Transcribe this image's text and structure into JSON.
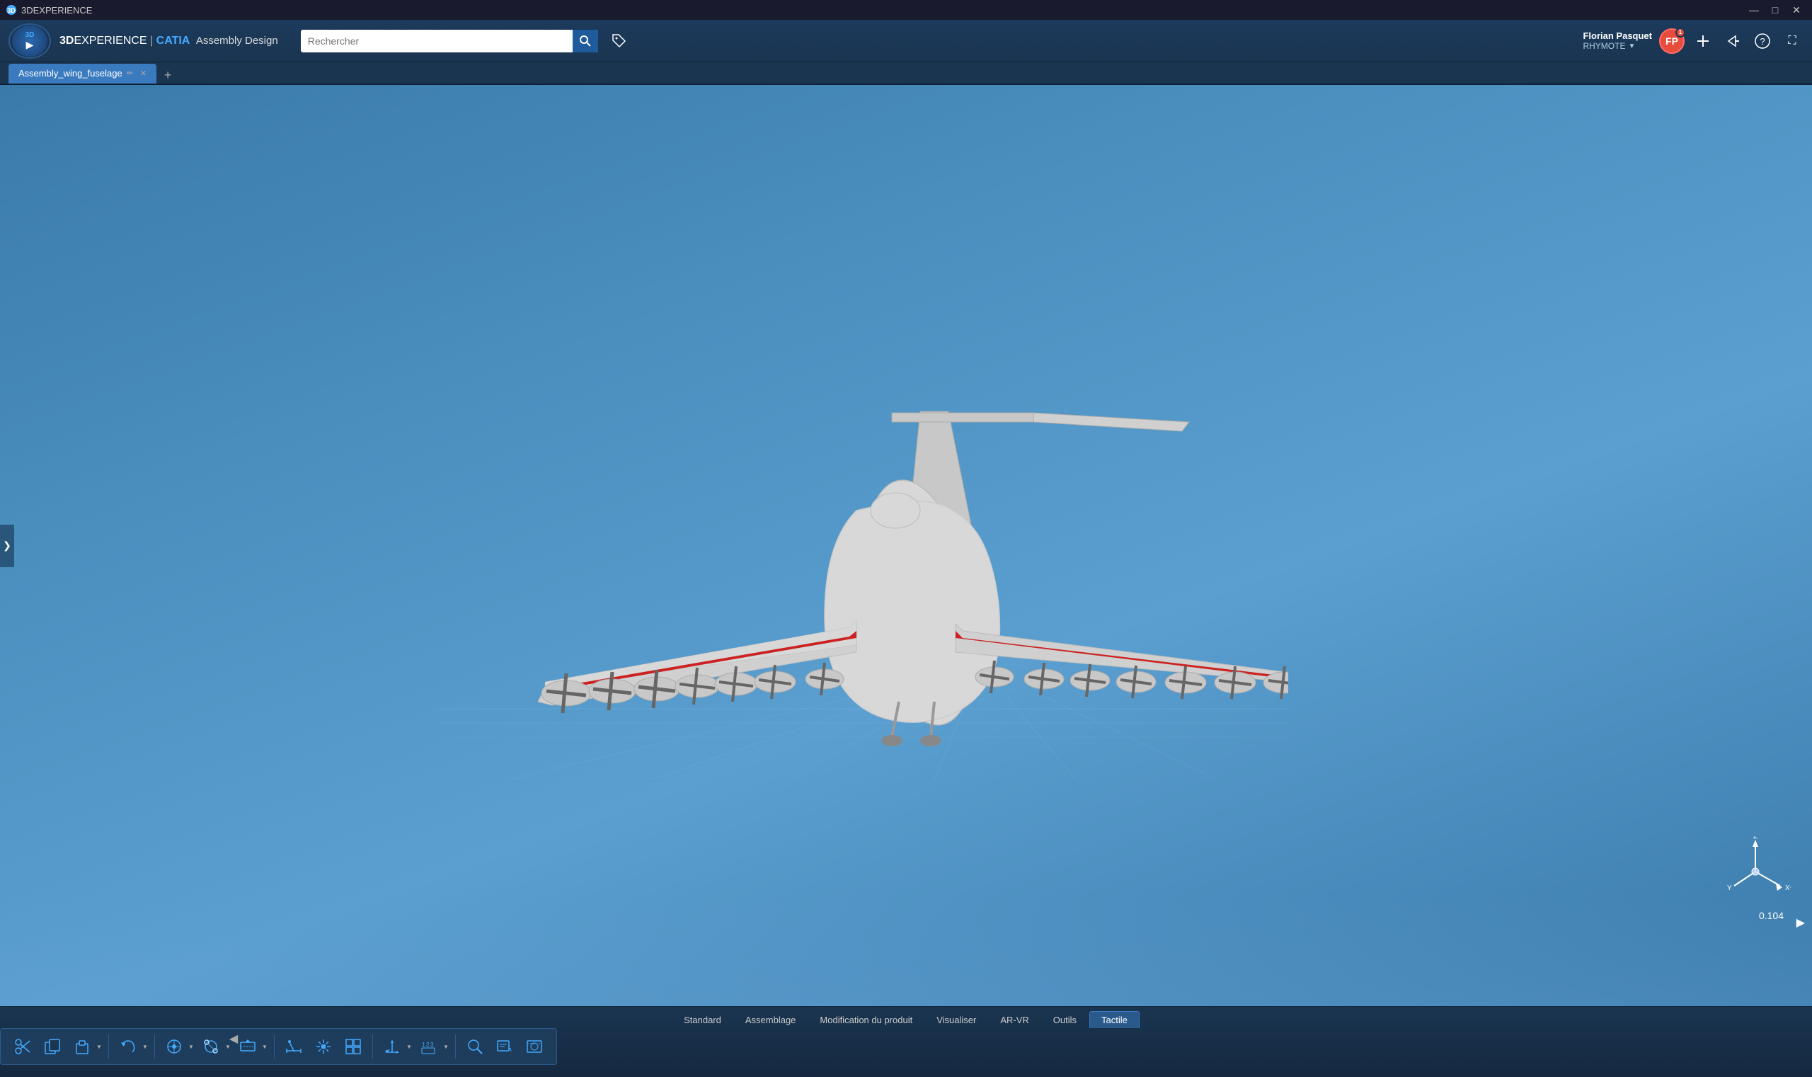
{
  "window": {
    "title": "3DEXPERIENCE",
    "minimize_label": "—",
    "maximize_label": "□",
    "close_label": "✕"
  },
  "header": {
    "app_prefix": "3D",
    "app_experience": "EXPERIENCE",
    "separator": " | ",
    "catia": "CATIA",
    "module": "Assembly Design",
    "search_placeholder": "Rechercher",
    "user_name": "Florian Pasquet",
    "workspace": "RHYMOTE",
    "avatar_initials": "FP"
  },
  "tabs": [
    {
      "label": "Assembly_wing_fuselage",
      "active": true
    },
    {
      "label": "+",
      "is_add": true
    }
  ],
  "viewport": {
    "coordinates": "0.104"
  },
  "sidebar": {
    "expand_icon": "❯"
  },
  "bottom_tabs": [
    {
      "label": "Standard",
      "active": false
    },
    {
      "label": "Assemblage",
      "active": false
    },
    {
      "label": "Modification du produit",
      "active": false
    },
    {
      "label": "Visualiser",
      "active": false
    },
    {
      "label": "AR-VR",
      "active": false
    },
    {
      "label": "Outils",
      "active": false
    },
    {
      "label": "Tactile",
      "active": false
    }
  ],
  "toolbar_buttons": [
    {
      "id": "scissors",
      "icon": "✂",
      "has_dropdown": false
    },
    {
      "id": "copy",
      "icon": "⧉",
      "has_dropdown": false
    },
    {
      "id": "paste",
      "icon": "📋",
      "has_dropdown": true
    },
    {
      "id": "undo",
      "icon": "↩",
      "has_dropdown": true
    },
    {
      "id": "transform",
      "icon": "⊕",
      "has_dropdown": true
    },
    {
      "id": "snap",
      "icon": "🔗",
      "has_dropdown": true
    },
    {
      "id": "section",
      "icon": "◈",
      "has_dropdown": true
    },
    {
      "id": "measure",
      "icon": "📏",
      "has_dropdown": false
    },
    {
      "id": "explode",
      "icon": "💥",
      "has_dropdown": false
    },
    {
      "id": "constraints",
      "icon": "⊞",
      "has_dropdown": false
    },
    {
      "id": "axis-system",
      "icon": "✛",
      "has_dropdown": true
    },
    {
      "id": "numbering",
      "icon": "🔢",
      "has_dropdown": true
    },
    {
      "id": "search-tool",
      "icon": "🔍",
      "has_dropdown": false
    },
    {
      "id": "annotation",
      "icon": "📝",
      "has_dropdown": false
    },
    {
      "id": "scene",
      "icon": "🎬",
      "has_dropdown": false
    }
  ]
}
